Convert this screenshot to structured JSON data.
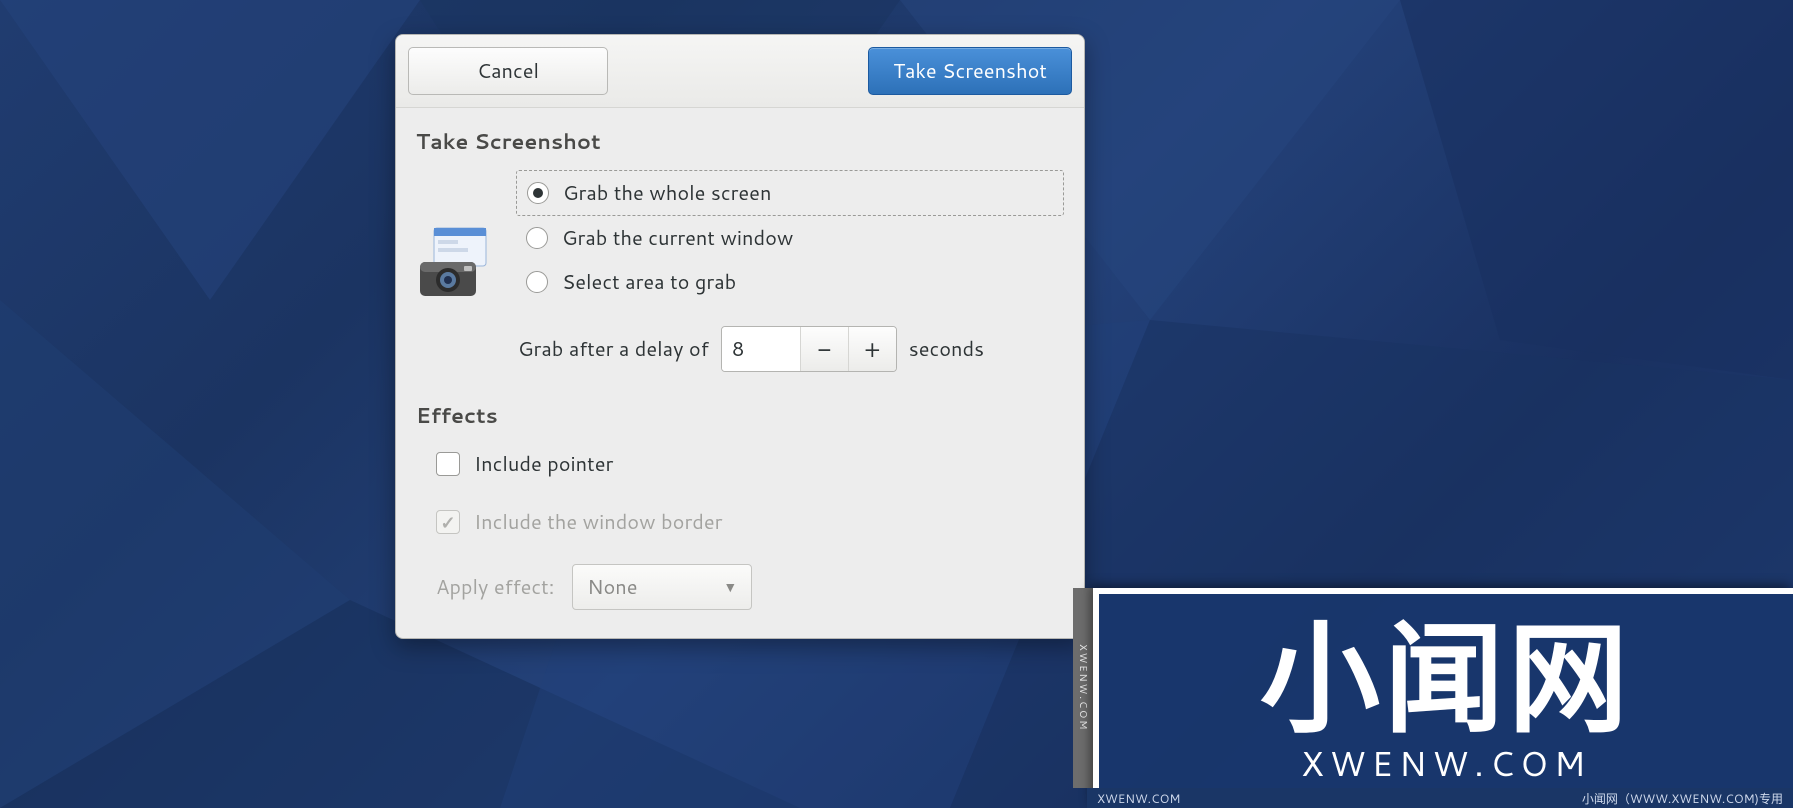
{
  "dialog": {
    "cancel_label": "Cancel",
    "take_label": "Take Screenshot"
  },
  "screenshot_section": {
    "title": "Take Screenshot",
    "options": [
      {
        "label": "Grab the whole screen",
        "selected": true
      },
      {
        "label": "Grab the current window",
        "selected": false
      },
      {
        "label": "Select area to grab",
        "selected": false
      }
    ],
    "delay": {
      "prefix": "Grab after a delay of",
      "value": "8",
      "suffix": "seconds"
    }
  },
  "effects_section": {
    "title": "Effects",
    "include_pointer": {
      "label": "Include pointer",
      "checked": false,
      "enabled": true
    },
    "include_border": {
      "label": "Include the window border",
      "checked": true,
      "enabled": false
    },
    "apply_effect": {
      "label": "Apply effect:",
      "value": "None",
      "enabled": false
    }
  },
  "watermark": {
    "big": "小闻网",
    "sub": "XWENW.COM",
    "side": "XWENW.COM",
    "footer_left": "XWENW.COM",
    "footer_right": "小闻网（WWW.XWENW.COM)专用"
  }
}
